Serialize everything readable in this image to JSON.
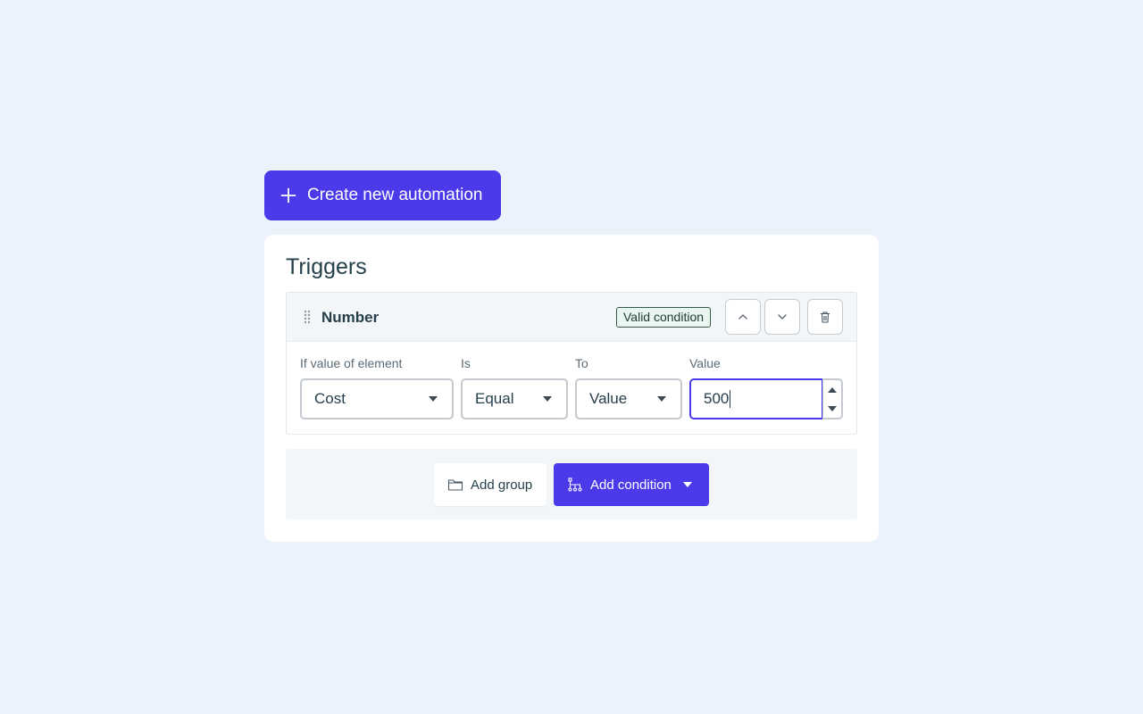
{
  "header": {
    "create_button_label": "Create new automation"
  },
  "triggers": {
    "title": "Triggers",
    "condition": {
      "name": "Number",
      "status_badge": "Valid condition",
      "fields": {
        "element_label": "If value of element",
        "element_value": "Cost",
        "operator_label": "Is",
        "operator_value": "Equal",
        "target_label": "To",
        "target_value": "Value",
        "value_label": "Value",
        "value_input": "500"
      }
    },
    "footer": {
      "add_group_label": "Add group",
      "add_condition_label": "Add condition"
    }
  },
  "colors": {
    "accent": "#4a3aea",
    "page_background": "#ebf2fc",
    "badge_background": "#e9f6ef",
    "badge_border": "#355a4c"
  },
  "icons": {
    "create": "plus-icon",
    "drag": "drag-handle-icon",
    "move_up": "chevron-up-icon",
    "move_down": "chevron-down-icon",
    "delete": "trash-icon",
    "group": "folder-icon",
    "condition": "branch-icon"
  }
}
